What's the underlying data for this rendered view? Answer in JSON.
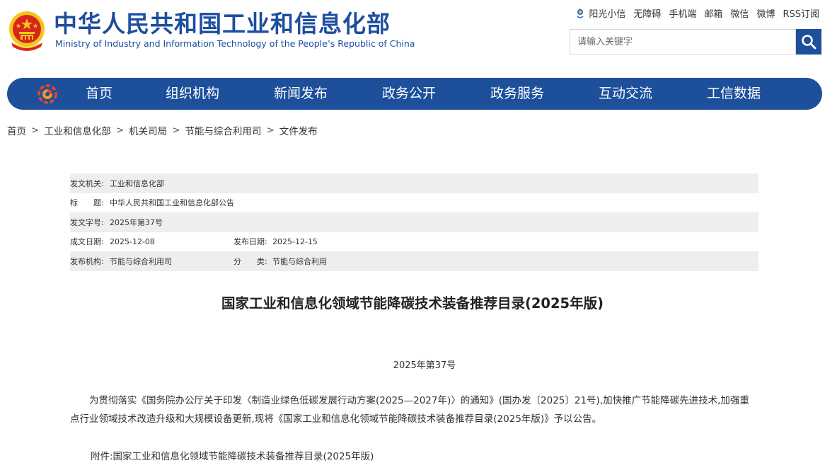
{
  "header": {
    "title_cn": "中华人民共和国工业和信息化部",
    "title_en": "Ministry of Industry and Information Technology of the People’s Republic of China",
    "emblem_icon": "national-emblem-icon",
    "top_links": [
      "阳光小信",
      "无障碍",
      "手机端",
      "邮箱",
      "微信",
      "微博",
      "RSS订阅"
    ],
    "search": {
      "placeholder": "请输入关键字",
      "button_icon": "search-icon"
    }
  },
  "nav": {
    "logo_icon": "miit-logo-icon",
    "items": [
      "首页",
      "组织机构",
      "新闻发布",
      "政务公开",
      "政务服务",
      "互动交流",
      "工信数据"
    ]
  },
  "breadcrumb": [
    "首页",
    "工业和信息化部",
    "机关司局",
    "节能与综合利用司",
    "文件发布"
  ],
  "meta": {
    "issuer_label": "发文机关:",
    "issuer": "工业和信息化部",
    "title_label": "标　　题:",
    "title": "中华人民共和国工业和信息化部公告",
    "doc_no_label": "发文字号:",
    "doc_no": "2025年第37号",
    "created_label": "成文日期:",
    "created": "2025-12-08",
    "published_label": "发布日期:",
    "published": "2025-12-15",
    "org_label": "发布机构:",
    "org": "节能与综合利用司",
    "category_label": "分　　类:",
    "category": "节能与综合利用"
  },
  "document": {
    "title": "国家工业和信息化领域节能降碳技术装备推荐目录(2025年版)",
    "number": "2025年第37号",
    "paragraph": "为贯彻落实《国务院办公厅关于印发〈制造业绿色低碳发展行动方案(2025—2027年)〉的通知》(国办发〔2025〕21号),加快推广节能降碳先进技术,加强重点行业领域技术改造升级和大规模设备更新,现将《国家工业和信息化领域节能降碳技术装备推荐目录(2025年版)》予以公告。",
    "attachment": "附件:国家工业和信息化领域节能降碳技术装备推荐目录(2025年版)"
  },
  "colors": {
    "brand_blue": "#1d4f9b",
    "title_blue": "#1e4ea1",
    "emblem_red": "#d7261e",
    "emblem_gold": "#f5c518"
  }
}
